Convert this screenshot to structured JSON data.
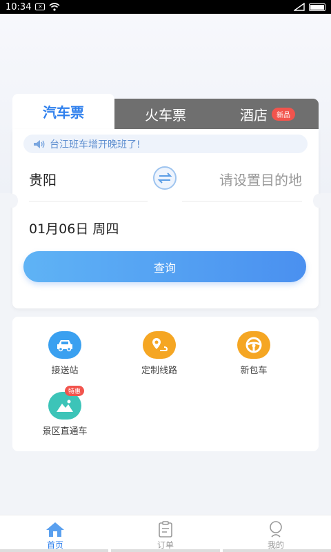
{
  "status_bar": {
    "time": "10:34"
  },
  "tabs": {
    "bus": "汽车票",
    "train": "火车票",
    "hotel": "酒店",
    "hotel_badge": "新品"
  },
  "notice": "台江班车增开晚班了!",
  "trip": {
    "from": "贵阳",
    "to_placeholder": "请设置目的地",
    "date": "01月06日 周四",
    "query_label": "查询"
  },
  "services": [
    {
      "label": "接送站",
      "icon": "car-icon",
      "color": "#3aa0f0"
    },
    {
      "label": "定制线路",
      "icon": "route-pin-icon",
      "color": "#f5a623"
    },
    {
      "label": "新包车",
      "icon": "steering-wheel-icon",
      "color": "#f5a623"
    },
    {
      "label": "景区直通车",
      "icon": "mountain-icon",
      "color": "#3cc4b8",
      "badge": "特惠"
    }
  ],
  "bottom_nav": {
    "home": "首页",
    "orders": "订单",
    "mine": "我的"
  },
  "colors": {
    "accent": "#2f80ed",
    "badge": "#f2544d"
  }
}
